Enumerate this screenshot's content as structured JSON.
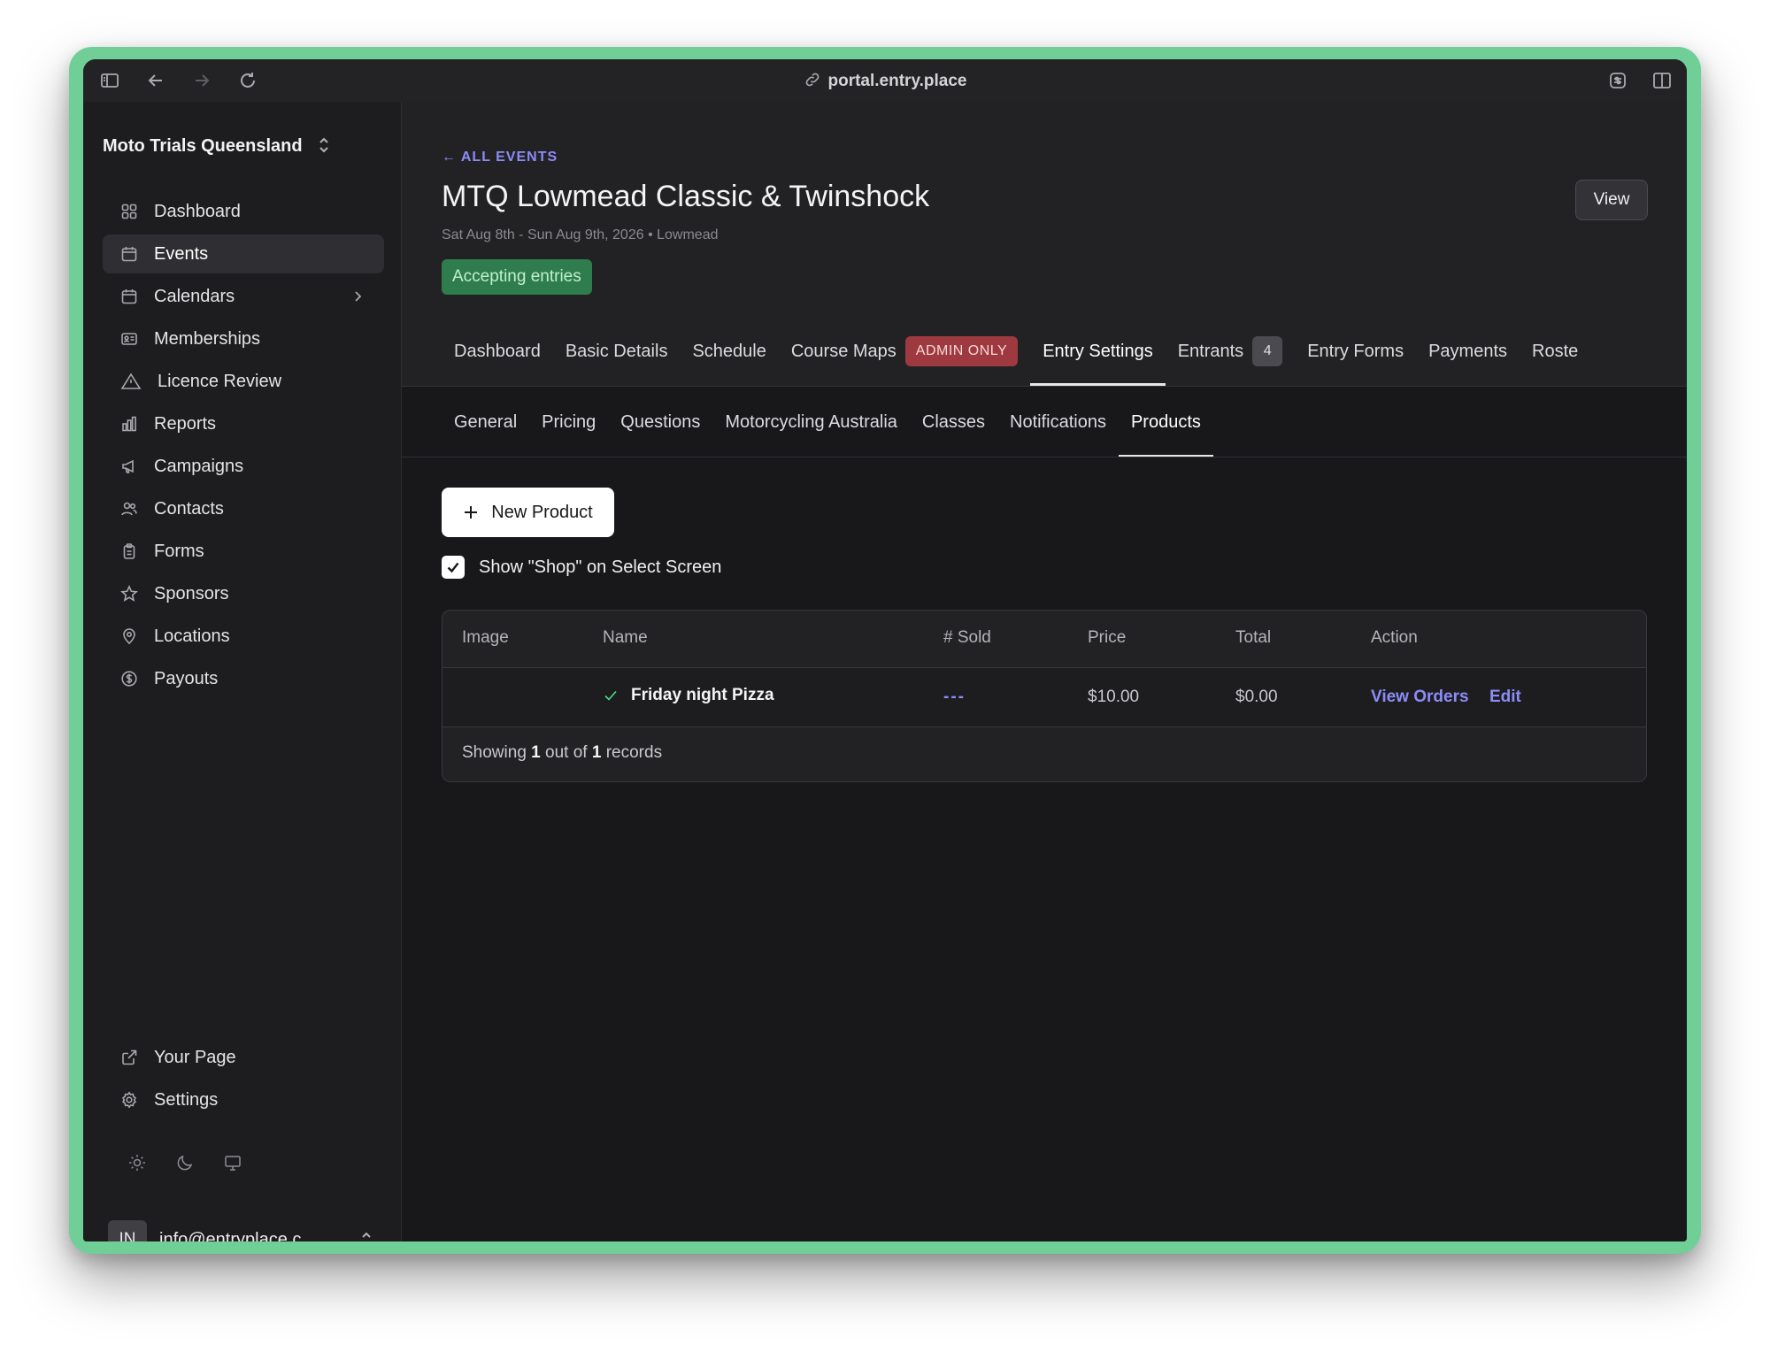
{
  "browser": {
    "url": "portal.entry.place"
  },
  "sidebar": {
    "org_name": "Moto Trials Queensland",
    "items": [
      {
        "label": "Dashboard",
        "icon": "grid-icon"
      },
      {
        "label": "Events",
        "icon": "calendar-icon",
        "active": true
      },
      {
        "label": "Calendars",
        "icon": "calendar-icon",
        "has_submenu": true
      },
      {
        "label": "Memberships",
        "icon": "id-card-icon"
      },
      {
        "label": "Licence Review",
        "icon": "warning-triangle-icon"
      },
      {
        "label": "Reports",
        "icon": "bar-chart-icon"
      },
      {
        "label": "Campaigns",
        "icon": "megaphone-icon"
      },
      {
        "label": "Contacts",
        "icon": "users-icon"
      },
      {
        "label": "Forms",
        "icon": "clipboard-icon"
      },
      {
        "label": "Sponsors",
        "icon": "star-icon"
      },
      {
        "label": "Locations",
        "icon": "map-pin-icon"
      },
      {
        "label": "Payouts",
        "icon": "dollar-circle-icon"
      }
    ],
    "bottom_items": [
      {
        "label": "Your Page",
        "icon": "external-link-icon"
      },
      {
        "label": "Settings",
        "icon": "gear-icon"
      }
    ],
    "user": {
      "initials": "IN",
      "email": "info@entryplace.c..."
    }
  },
  "event": {
    "back_label": "ALL EVENTS",
    "title": "MTQ Lowmead Classic & Twinshock",
    "subtitle": "Sat Aug 8th - Sun Aug 9th, 2026 • Lowmead",
    "status": "Accepting entries",
    "view_label": "View"
  },
  "tabs": [
    {
      "label": "Dashboard"
    },
    {
      "label": "Basic Details"
    },
    {
      "label": "Schedule"
    },
    {
      "label": "Course Maps",
      "badge": "ADMIN ONLY"
    },
    {
      "label": "Entry Settings",
      "active": true
    },
    {
      "label": "Entrants",
      "count": "4"
    },
    {
      "label": "Entry Forms"
    },
    {
      "label": "Payments"
    },
    {
      "label": "Roste"
    }
  ],
  "subtabs": [
    {
      "label": "General"
    },
    {
      "label": "Pricing"
    },
    {
      "label": "Questions"
    },
    {
      "label": "Motorcycling Australia"
    },
    {
      "label": "Classes"
    },
    {
      "label": "Notifications"
    },
    {
      "label": "Products",
      "active": true
    }
  ],
  "products": {
    "new_label": "New Product",
    "show_shop_label": "Show \"Shop\" on Select Screen",
    "show_shop_checked": true,
    "columns": [
      "Image",
      "Name",
      "# Sold",
      "Price",
      "Total",
      "Action"
    ],
    "rows": [
      {
        "name": "Friday night Pizza",
        "sold": "---",
        "price": "$10.00",
        "total": "$0.00",
        "view_label": "View Orders",
        "edit_label": "Edit"
      }
    ],
    "footer": {
      "prefix": "Showing",
      "shown": "1",
      "middle": "out of",
      "total": "1",
      "suffix": "records"
    }
  }
}
